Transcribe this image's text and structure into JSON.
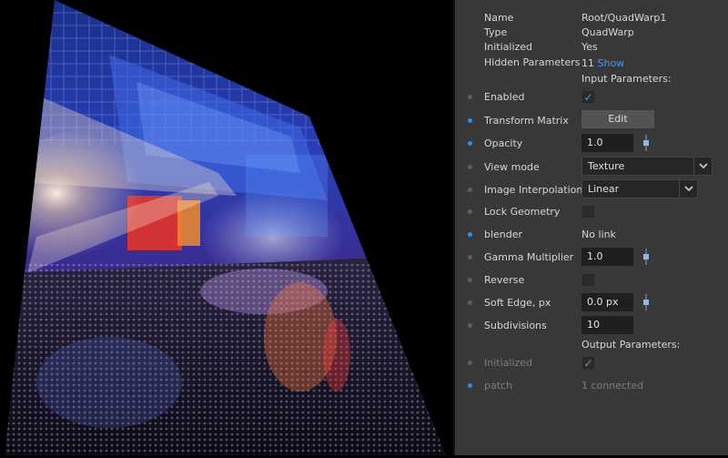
{
  "info": {
    "name_label": "Name",
    "name_value": "Root/QuadWarp1",
    "type_label": "Type",
    "type_value": "QuadWarp",
    "initialized_label": "Initialized",
    "initialized_value": "Yes",
    "hidden_label": "Hidden Parameters",
    "hidden_count": "11",
    "show_link": "Show"
  },
  "input_header": "Input Parameters:",
  "output_header": "Output Parameters:",
  "params": {
    "enabled": {
      "label": "Enabled",
      "checked": true
    },
    "transform_matrix": {
      "label": "Transform Matrix",
      "button": "Edit"
    },
    "opacity": {
      "label": "Opacity",
      "value": "1.0"
    },
    "view_mode": {
      "label": "View mode",
      "value": "Texture"
    },
    "image_interpolation": {
      "label": "Image Interpolation",
      "value": "Linear"
    },
    "lock_geometry": {
      "label": "Lock Geometry",
      "checked": false
    },
    "blender": {
      "label": "blender",
      "value": "No link"
    },
    "gamma_multiplier": {
      "label": "Gamma Multiplier",
      "value": "1.0"
    },
    "reverse": {
      "label": "Reverse",
      "checked": false
    },
    "soft_edge": {
      "label": "Soft Edge, px",
      "value": "0.0 px"
    },
    "subdivisions": {
      "label": "Subdivisions",
      "value": "10"
    }
  },
  "outputs": {
    "initialized": {
      "label": "Initialized",
      "checked": true
    },
    "patch": {
      "label": "patch",
      "value": "1 connected"
    }
  },
  "glyphs": {
    "check": "✓"
  },
  "colors": {
    "panel_bg": "#383838",
    "accent_blue": "#2f8fe8",
    "link_blue": "#3d9cf0",
    "field_bg": "#1f1f1f",
    "dim_text": "#7d7d7d"
  }
}
